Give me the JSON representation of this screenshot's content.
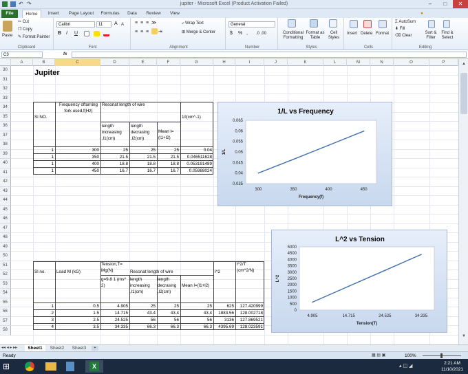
{
  "window": {
    "title": "jupiter - Microsoft Excel (Product Activation Failed)"
  },
  "tabs": [
    "File",
    "Home",
    "Insert",
    "Page Layout",
    "Formulas",
    "Data",
    "Review",
    "View"
  ],
  "ribbon": {
    "clipboard": {
      "paste": "Paste",
      "cut": "Cut",
      "copy": "Copy",
      "format_painter": "Format Painter",
      "label": "Clipboard"
    },
    "font": {
      "name": "Calibri",
      "size": "11",
      "label": "Font",
      "bold": "B",
      "italic": "I",
      "underline": "U",
      "grow": "A",
      "shrink": "A"
    },
    "alignment": {
      "wrap": "Wrap Text",
      "merge": "Merge & Center",
      "label": "Alignment"
    },
    "number": {
      "format": "General",
      "currency": "$",
      "percent": "%",
      "comma": ",",
      "label": "Number"
    },
    "styles": {
      "conditional": "Conditional Formatting",
      "format_table": "Format as Table",
      "cell_styles": "Cell Styles",
      "label": "Styles"
    },
    "cells": {
      "insert": "Insert",
      "delete": "Delete",
      "format": "Format",
      "label": "Cells"
    },
    "editing": {
      "autosum": "AutoSum",
      "fill": "Fill",
      "clear": "Clear",
      "sort": "Sort & Filter",
      "find": "Find & Select",
      "label": "Editing"
    }
  },
  "formula_bar": {
    "name_box": "C3",
    "fx": "fx",
    "value": ""
  },
  "columns": [
    "A",
    "B",
    "C",
    "D",
    "E",
    "F",
    "G",
    "H",
    "I",
    "J",
    "K",
    "L",
    "M",
    "N",
    "O",
    "P"
  ],
  "rows": [
    "30",
    "31",
    "32",
    "33",
    "34",
    "35",
    "36",
    "37",
    "38",
    "39",
    "40",
    "41",
    "42",
    "43",
    "44",
    "45",
    "46",
    "47",
    "48",
    "49",
    "50",
    "51",
    "52",
    "53",
    "54",
    "55",
    "56",
    "57",
    "58"
  ],
  "sheet": {
    "heading": "Jupiter",
    "table1": {
      "h_sl": "Sl NO.",
      "h_freq": "Frequency ofturning fork used,f(Hz)",
      "h_resonat": "Resonat length of wire",
      "h_inv": "1/l(cm^-1)",
      "h_l1": "length increasing ,l1(cm)",
      "h_l2": "length decrasing ,l2(cm)",
      "h_mean": "Mean l=(l1+l2)",
      "rows": [
        [
          "1",
          "300",
          "25",
          "25",
          "25",
          "0.04"
        ],
        [
          "1",
          "350",
          "21.5",
          "21.5",
          "21.5",
          "0.046511628"
        ],
        [
          "1",
          "400",
          "18.8",
          "18.8",
          "18.8",
          "0.053191489"
        ],
        [
          "1",
          "450",
          "16.7",
          "16.7",
          "16.7",
          "0.05988024"
        ]
      ]
    },
    "table2": {
      "h_sl": "Sl no.",
      "h_load": "Load M (kG)",
      "h_tension": "Tension,T= Mg(N)",
      "h_g": "g=9.8 1 (ms^ 2)",
      "h_resonat": "Resonat length of wire",
      "h_l1": "length increasing ,l1(cm)",
      "h_l2": "length decrasing ,l2(cm)",
      "h_mean": "Mean l=(l1+l2)",
      "h_l2sq": "l^2",
      "h_ratio": "l^2/T (cm^2/N)",
      "rows": [
        [
          "1",
          "0.5",
          "4.905",
          "25",
          "25",
          "25",
          "625",
          "127.420999"
        ],
        [
          "2",
          "1.5",
          "14.715",
          "43.4",
          "43.4",
          "43.4",
          "1883.56",
          "128.002718"
        ],
        [
          "3",
          "2.5",
          "24.525",
          "56",
          "56",
          "56",
          "3136",
          "127.869521"
        ],
        [
          "4",
          "3.5",
          "34.335",
          "66.3",
          "66.3",
          "66.3",
          "4395.69",
          "128.023591"
        ]
      ]
    }
  },
  "chart_data": [
    {
      "type": "line",
      "title": "1/L vs Frequency",
      "xlabel": "Frequency(f)",
      "ylabel": "1/L",
      "x": [
        300,
        350,
        400,
        450
      ],
      "xticks": [
        "300",
        "350",
        "400",
        "450"
      ],
      "yticks": [
        "0.035",
        "0.04",
        "0.045",
        "0.05",
        "0.055",
        "0.06",
        "0.065"
      ],
      "ylim": [
        0.035,
        0.065
      ],
      "values": [
        0.04,
        0.046511628,
        0.053191489,
        0.05988024
      ],
      "color": "#3f6fb5"
    },
    {
      "type": "line",
      "title": "L^2 vs Tension",
      "xlabel": "Tension(T)",
      "ylabel": "L^2",
      "x": [
        4.905,
        14.715,
        24.525,
        34.335
      ],
      "xticks": [
        "4.905",
        "14.715",
        "24.525",
        "34.335"
      ],
      "yticks": [
        "0",
        "500",
        "1000",
        "1500",
        "2000",
        "2500",
        "3000",
        "3500",
        "4000",
        "4500",
        "5000"
      ],
      "ylim": [
        0,
        5000
      ],
      "values": [
        625,
        1883.56,
        3136,
        4395.69
      ],
      "color": "#3f6fb5"
    }
  ],
  "sheet_tabs": [
    "Sheet1",
    "Sheet2",
    "Sheet3"
  ],
  "status": {
    "ready": "Ready",
    "zoom": "100%"
  },
  "taskbar": {
    "time": "2:21 AM",
    "date": "11/10/2021"
  }
}
